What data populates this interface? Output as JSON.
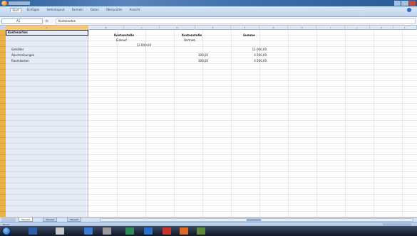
{
  "window": {
    "title": ""
  },
  "ribbon": {
    "tabs": [
      {
        "label": "Start"
      },
      {
        "label": "Einfügen"
      },
      {
        "label": "Seitenlayout"
      },
      {
        "label": "Formeln"
      },
      {
        "label": "Daten"
      },
      {
        "label": "Überprüfen"
      },
      {
        "label": "Ansicht"
      }
    ]
  },
  "formula_bar": {
    "name_box": "A1",
    "fx": "fx",
    "content": "Kostenarten"
  },
  "columns": [
    "A",
    "B",
    "C",
    "D",
    "E",
    "F",
    "G",
    "H",
    "I",
    "J",
    "K",
    "L"
  ],
  "sheet": {
    "header_row": {
      "a": "Kostenarten",
      "b": "Kostenstelle",
      "c": "Kostenstelle",
      "d": "Summe"
    },
    "sub_header_row": {
      "b": "Einkauf",
      "c": "Vertrieb"
    },
    "rows": [
      {
        "label": "Gehälter",
        "b": "12.000,00",
        "c": "",
        "d": "12.000,00"
      },
      {
        "label": "Abschreibungen",
        "b": "",
        "c": "300,00",
        "d": "4.500,00"
      },
      {
        "label": "Raumkosten",
        "b": "",
        "c": "300,00",
        "d": "4.500,00"
      }
    ]
  },
  "sheet_tabs": [
    {
      "label": "Tabelle1",
      "active": true
    },
    {
      "label": "Tabelle2",
      "active": false
    },
    {
      "label": "Tabelle3",
      "active": false
    }
  ],
  "status": {
    "text": "Bereit"
  },
  "taskbar": {
    "clock": ""
  },
  "colors": {
    "row_header": "#e9b347",
    "selected_column_header": "#f6c873",
    "ribbon": "#bfd3ee",
    "taskbar": "#111827"
  },
  "icons": {
    "office_button": "office-orb-icon",
    "start": "windows-start-icon",
    "help": "help-icon"
  }
}
